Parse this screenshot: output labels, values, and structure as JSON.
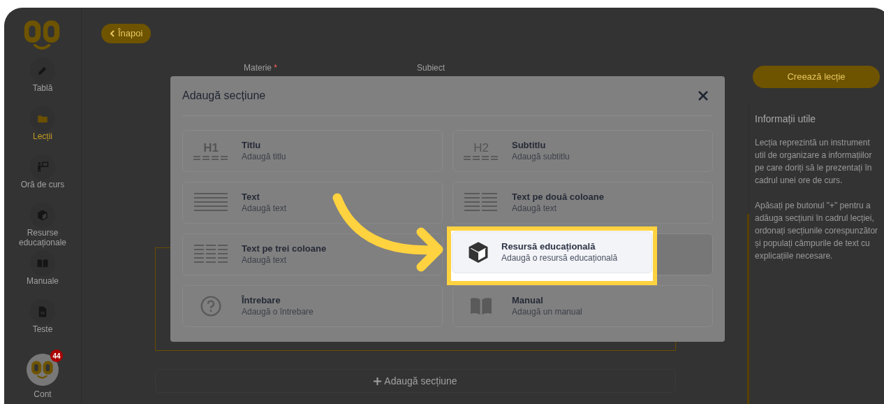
{
  "sidebar": {
    "items": [
      {
        "label": "Tablă",
        "selected": false
      },
      {
        "label": "Lecții",
        "selected": true
      },
      {
        "label": "Oră de curs",
        "selected": false
      },
      {
        "label": "Resurse educaționale",
        "selected": false
      },
      {
        "label": "Manuale",
        "selected": false
      },
      {
        "label": "Teste",
        "selected": false
      }
    ],
    "account": {
      "label": "Cont",
      "badge": "44"
    }
  },
  "back_button": "Înapoi",
  "form": {
    "fields": [
      {
        "label": "Materie",
        "required_mark": "*"
      },
      {
        "label": "Subiect"
      }
    ]
  },
  "add_section_button": "Adaugă secțiune",
  "create_button": "Creează lecție",
  "info": {
    "title": "Informații utile",
    "paragraphs": [
      "Lecția reprezintă un instrument util de organizare a informațiilor pe care doriți să le prezentați în cadrul unei ore de curs.",
      "Apăsați pe butonul \"+\" pentru a adăuga secțiuni în cadrul lecției, ordonați secțiunile corespunzător și populați câmpurile de text cu explicațiile necesare."
    ]
  },
  "modal": {
    "title": "Adaugă secțiune",
    "options": [
      {
        "kind": "h1",
        "icon_text": "H1",
        "title": "Titlu",
        "subtitle": "Adaugă titlu",
        "highlighted": false
      },
      {
        "kind": "h2",
        "icon_text": "H2",
        "title": "Subtitlu",
        "subtitle": "Adaugă subtitlu",
        "highlighted": false
      },
      {
        "kind": "text",
        "title": "Text",
        "subtitle": "Adaugă text",
        "highlighted": false
      },
      {
        "kind": "two_columns",
        "title": "Text pe două coloane",
        "subtitle": "Adaugă text",
        "highlighted": false
      },
      {
        "kind": "three_columns",
        "title": "Text pe trei coloane",
        "subtitle": "Adaugă text",
        "highlighted": false
      },
      {
        "kind": "resource",
        "title": "Resursă educațională",
        "subtitle": "Adaugă o resursă educațională",
        "highlighted": true
      },
      {
        "kind": "question",
        "title": "Întrebare",
        "subtitle": "Adaugă o întrebare",
        "highlighted": false
      },
      {
        "kind": "manual",
        "title": "Manual",
        "subtitle": "Adaugă un manual",
        "highlighted": false
      }
    ]
  }
}
